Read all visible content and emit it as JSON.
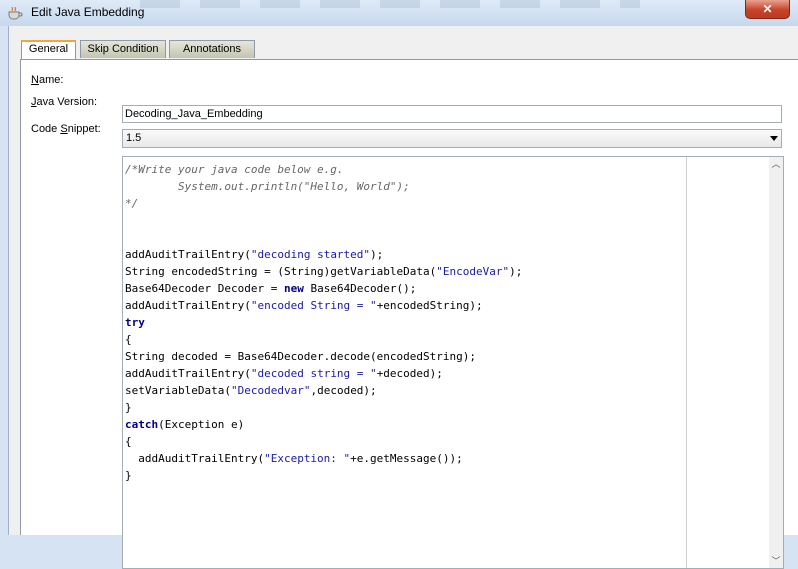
{
  "window": {
    "title": "Edit Java Embedding",
    "close_label": "✕"
  },
  "tabs": [
    {
      "label": "General",
      "active": true
    },
    {
      "label": "Skip Condition",
      "active": false
    },
    {
      "label": "Annotations",
      "active": false
    }
  ],
  "form": {
    "name_label_u": "N",
    "name_label_rest": "ame:",
    "name_value": "Decoding_Java_Embedding",
    "java_label_u": "J",
    "java_label_rest": "ava Version:",
    "java_version": "1.5",
    "snippet_label_pre": "Code ",
    "snippet_label_u": "S",
    "snippet_label_rest": "nippet:"
  },
  "code_lines": [
    [
      [
        "cm",
        "/*Write your java code below e.g."
      ]
    ],
    [
      [
        "cm",
        "\tSystem.out.println(\"Hello, World\");"
      ]
    ],
    [
      [
        "cm",
        "*/"
      ]
    ],
    [],
    [],
    [
      [
        "t",
        "addAuditTrailEntry("
      ],
      [
        "str",
        "\"decoding started\""
      ],
      [
        "t",
        ");"
      ]
    ],
    [
      [
        "t",
        "String encodedString = (String)getVariableData("
      ],
      [
        "str",
        "\"EncodeVar\""
      ],
      [
        "t",
        ");"
      ]
    ],
    [
      [
        "t",
        "Base64Decoder Decoder = "
      ],
      [
        "kw",
        "new"
      ],
      [
        "t",
        " Base64Decoder();"
      ]
    ],
    [
      [
        "t",
        "addAuditTrailEntry("
      ],
      [
        "str",
        "\"encoded String = \""
      ],
      [
        "t",
        "+encodedString);"
      ]
    ],
    [
      [
        "kw",
        "try"
      ]
    ],
    [
      [
        "t",
        "{"
      ]
    ],
    [
      [
        "t",
        "String decoded = Base64Decoder.decode(encodedString);"
      ]
    ],
    [
      [
        "t",
        "addAuditTrailEntry("
      ],
      [
        "str",
        "\"decoded string = \""
      ],
      [
        "t",
        "+decoded);"
      ]
    ],
    [
      [
        "t",
        "setVariableData("
      ],
      [
        "str",
        "\"Decodedvar\""
      ],
      [
        "t",
        ",decoded);"
      ]
    ],
    [
      [
        "t",
        "}"
      ]
    ],
    [
      [
        "kw",
        "catch"
      ],
      [
        "t",
        "(Exception e)"
      ]
    ],
    [
      [
        "t",
        "{"
      ]
    ],
    [
      [
        "t",
        "  addAuditTrailEntry("
      ],
      [
        "str",
        "\"Exception: \""
      ],
      [
        "t",
        "+e.getMessage());"
      ]
    ],
    [
      [
        "t",
        "}"
      ]
    ]
  ],
  "colors": {
    "string": "#1a1aa6",
    "keyword": "#00008b",
    "comment": "#666666",
    "tab_accent": "#f2a53b"
  },
  "icons": {
    "app": "coffee-cup-icon",
    "close": "close-icon",
    "dropdown": "chevron-down-icon",
    "scroll_up": "scroll-up-arrow-icon",
    "scroll_down": "scroll-down-arrow-icon"
  }
}
